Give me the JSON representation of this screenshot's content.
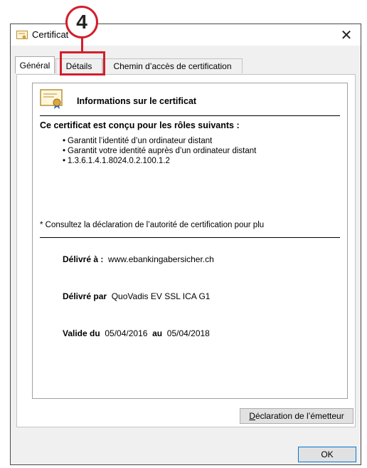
{
  "window": {
    "title": "Certificat"
  },
  "tabs": [
    {
      "label": "Général"
    },
    {
      "label": "Détails"
    },
    {
      "label": "Chemin d’accès de certification"
    }
  ],
  "info": {
    "heading": "Informations sur le certificat",
    "roles_title": "Ce certificat est conçu pour les rôles suivants :",
    "roles": [
      "Garantit l’identité d’un ordinateur distant",
      "Garantit votre identité auprès d’un ordinateur distant",
      "1.3.6.1.4.1.8024.0.2.100.1.2"
    ],
    "note": "* Consultez la déclaration de l’autorité de certification pour plu",
    "issued_to_label": "Délivré à :",
    "issued_to": "www.ebankingabersicher.ch",
    "issued_by_label": "Délivré par",
    "issued_by": "QuoVadis EV SSL ICA G1",
    "valid_from_label": "Valide du",
    "valid_from": "05/04/2016",
    "valid_to_label": "au",
    "valid_to": "05/04/2018"
  },
  "buttons": {
    "issuer_statement_first": "D",
    "issuer_statement_rest": "éclaration de l’émetteur",
    "ok": "OK"
  },
  "callout": {
    "number": "4",
    "color": "#d21f2b"
  },
  "icons": [
    "certificate-icon",
    "close-icon"
  ]
}
